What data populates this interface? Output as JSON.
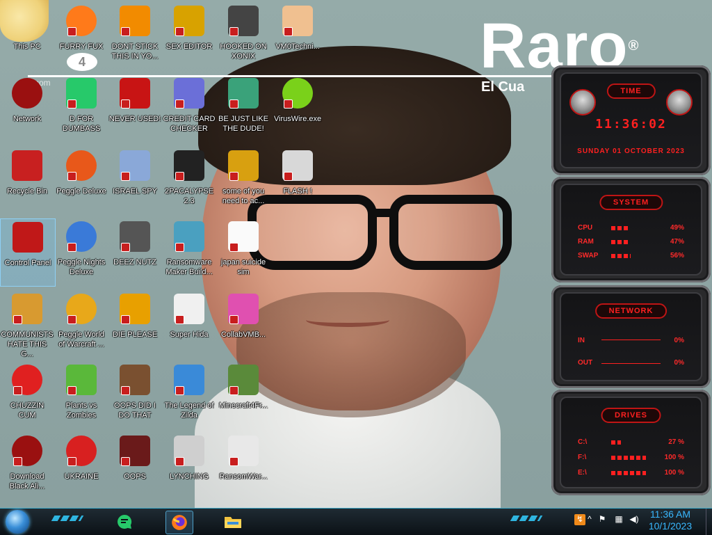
{
  "wallpaper": {
    "title": "Raro",
    "title_mark": "®",
    "subtitle": "El Cua",
    "faded_text": "2 com",
    "badge_text": "4"
  },
  "icons": [
    {
      "id": "this-pc",
      "label": "This PC",
      "icon": "cartoon-icon"
    },
    {
      "id": "furry-fux",
      "label": "FURRY FUX",
      "icon": "firefox-icon",
      "color": "#ff7a1a"
    },
    {
      "id": "dont-stick",
      "label": "DONT STICK THIS IN YO...",
      "icon": "vlc-cone-icon",
      "color": "#f28b00"
    },
    {
      "id": "sex-editor",
      "label": "SEX EDITOR",
      "icon": "hxd-icon",
      "color": "#d8a200"
    },
    {
      "id": "hooked-on-xonix",
      "label": "HOOKED ON XONIX",
      "icon": "xonix-icon",
      "color": "#444"
    },
    {
      "id": "vm0",
      "label": "VM0Techni...",
      "icon": "doctor-icon",
      "color": "#f0c090"
    },
    {
      "id": "network",
      "label": "Network",
      "icon": "alien-orb-icon",
      "color": "#9a1010"
    },
    {
      "id": "dumbass",
      "label": "D FOR DUMBASS",
      "icon": "chat-bubble-icon",
      "color": "#27c96a"
    },
    {
      "id": "never-used",
      "label": "NEVER USED!",
      "icon": "devcpp-icon",
      "color": "#c81414"
    },
    {
      "id": "credit-card",
      "label": "CREDIT CARD CHECKER",
      "icon": "credit-card-icon",
      "color": "#6b6fd8"
    },
    {
      "id": "just-like-dude",
      "label": "BE JUST LIKE THE DUDE!",
      "icon": "santa-icon",
      "color": "#3aa27a"
    },
    {
      "id": "viruswire",
      "label": "VirusWire.exe",
      "icon": "lime-icon",
      "color": "#7ad11a"
    },
    {
      "id": "recycle-bin",
      "label": "Recycle Bin",
      "icon": "trash-bin-icon",
      "color": "#c82020"
    },
    {
      "id": "peggle-deluxe",
      "label": "Peggle Deluxe",
      "icon": "peggle-icon",
      "color": "#e8581a"
    },
    {
      "id": "israel-spy",
      "label": "ISRAEL SPY",
      "icon": "monitor-icon",
      "color": "#8aa8d8"
    },
    {
      "id": "2pacalypse",
      "label": "2PACALYPSE 2.3",
      "icon": "terminal-icon",
      "color": "#222"
    },
    {
      "id": "some-of-you",
      "label": "some of you need to ac...",
      "icon": "dog-icon",
      "color": "#d8a010"
    },
    {
      "id": "flash",
      "label": "FLASH !",
      "icon": "flash-icon",
      "color": "#d8d8d8"
    },
    {
      "id": "control-panel",
      "label": "Control Panel",
      "icon": "control-panel-icon",
      "color": "#c01818",
      "selected": true
    },
    {
      "id": "peggle-nights",
      "label": "Peggle Nights Deluxe",
      "icon": "peggle-icon",
      "color": "#3a7ad8"
    },
    {
      "id": "deez-nutz",
      "label": "DEEZ NUTZ",
      "icon": "stack-icon",
      "color": "#555"
    },
    {
      "id": "ransomware-maker",
      "label": "Ransomware Maker Build...",
      "icon": "window-icon",
      "color": "#4aa0c0"
    },
    {
      "id": "japan-suicide",
      "label": "japan suicide sim",
      "icon": "bars-icon",
      "color": "#fafafa"
    },
    {
      "id": "communists",
      "label": "COMMUNISTS HATE THIS G...",
      "icon": "money-bag-icon",
      "color": "#d89a30"
    },
    {
      "id": "peggle-wow",
      "label": "Peggle World of Warcraft ...",
      "icon": "peggle-icon",
      "color": "#e8a81a"
    },
    {
      "id": "die-please",
      "label": "DIE PLEASE",
      "icon": "de-icon",
      "color": "#e8a000"
    },
    {
      "id": "super-hida",
      "label": "Super Hida",
      "icon": "pixel-cat-icon",
      "color": "#f0f0f0"
    },
    {
      "id": "collabvmb",
      "label": "CollabVMB...",
      "icon": "monitor-pink-icon",
      "color": "#e050b0"
    },
    {
      "id": "chuzzin-cum",
      "label": "CHUZZIN CUM",
      "icon": "chuzzle-icon",
      "color": "#e02020"
    },
    {
      "id": "plants-zombies",
      "label": "Plants vs Zombies",
      "icon": "plant-icon",
      "color": "#5ab83a"
    },
    {
      "id": "oops-did",
      "label": "OOPS DID I DO THAT",
      "icon": "portrait-icon",
      "color": "#7a5030"
    },
    {
      "id": "legend-zilda",
      "label": "The Legend of Zilda",
      "icon": "pixel-hero-icon",
      "color": "#3a8ad8"
    },
    {
      "id": "minecraft",
      "label": "Minecraft4Fr...",
      "icon": "grass-block-icon",
      "color": "#5a8a3a"
    },
    {
      "id": "black-alien",
      "label": "Download Black Ali...",
      "icon": "alien-orb-icon",
      "color": "#9a1010"
    },
    {
      "id": "ukraine",
      "label": "UKRAINE",
      "icon": "radiation-icon",
      "color": "#d82020"
    },
    {
      "id": "oops",
      "label": "OOPS",
      "icon": "book-icon",
      "color": "#6a1a1a"
    },
    {
      "id": "lynching",
      "label": "LYNCHING",
      "icon": "noose-icon",
      "color": "#cfcfcf"
    },
    {
      "id": "ransomwar",
      "label": "RansomWar...",
      "icon": "skull-icon",
      "color": "#e8e8e8"
    }
  ],
  "gadgets": {
    "time": {
      "header": "TIME",
      "clock": "11:36:02",
      "date": "SUNDAY 01 OCTOBER 2023"
    },
    "system": {
      "header": "SYSTEM",
      "rows": [
        {
          "key": "CPU",
          "value": "49%",
          "level": 0.49
        },
        {
          "key": "RAM",
          "value": "47%",
          "level": 0.47
        },
        {
          "key": "SWAP",
          "value": "56%",
          "level": 0.56
        }
      ]
    },
    "network": {
      "header": "NETWORK",
      "rows": [
        {
          "key": "IN",
          "value": "0%"
        },
        {
          "key": "OUT",
          "value": "0%"
        }
      ]
    },
    "drives": {
      "header": "DRIVES",
      "rows": [
        {
          "key": "C:\\",
          "value": "27 %",
          "level": 0.27
        },
        {
          "key": "F:\\",
          "value": "100 %",
          "level": 1.0
        },
        {
          "key": "E:\\",
          "value": "100 %",
          "level": 1.0
        }
      ]
    }
  },
  "taskbar": {
    "pinned": [
      {
        "name": "chat-app",
        "icon": "chat-bubble-icon"
      },
      {
        "name": "firefox",
        "icon": "firefox-icon",
        "active": true
      },
      {
        "name": "file-explorer",
        "icon": "folder-icon"
      }
    ],
    "tray": [
      "update-icon",
      "chevron-up-icon",
      "flag-icon",
      "network-icon",
      "volume-icon"
    ],
    "time": "11:36 AM",
    "date": "10/1/2023"
  },
  "colors": {
    "gadget_red": "#ff2020",
    "taskbar_accent": "#2fb5e0",
    "clock_blue": "#39b8ff"
  }
}
